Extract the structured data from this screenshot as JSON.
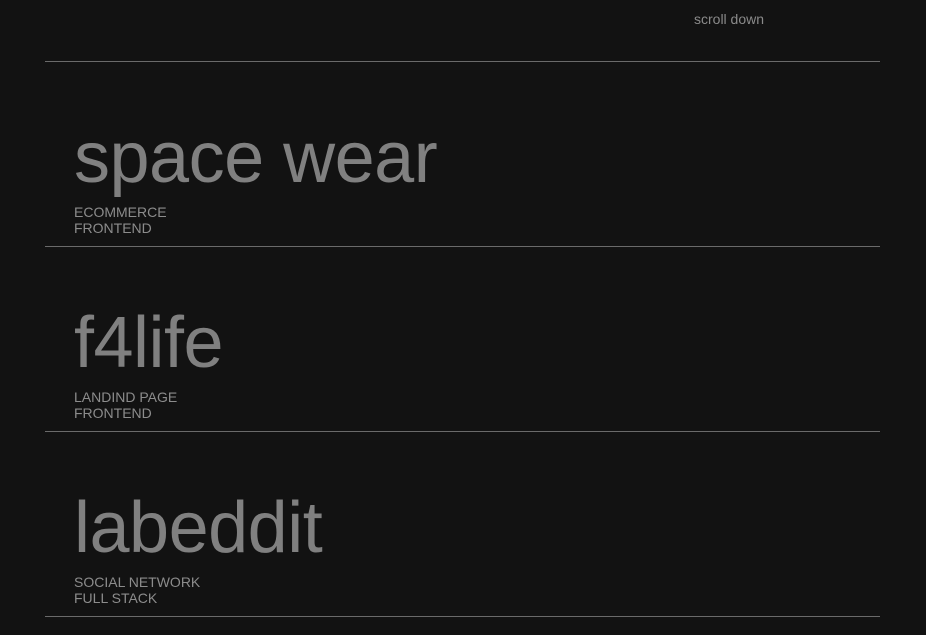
{
  "header": {
    "scroll_hint": "scroll down"
  },
  "projects": [
    {
      "title": "space wear",
      "tags": [
        "ECOMMERCE",
        "FRONTEND"
      ]
    },
    {
      "title": "f4life",
      "tags": [
        "LANDIND PAGE",
        "FRONTEND"
      ]
    },
    {
      "title": "labeddit",
      "tags": [
        "SOCIAL NETWORK",
        "FULL STACK"
      ]
    }
  ],
  "colors": {
    "background": "#121212",
    "title_text": "#808080",
    "tag_text": "#8c8c8c",
    "divider": "#6a6a6a"
  }
}
